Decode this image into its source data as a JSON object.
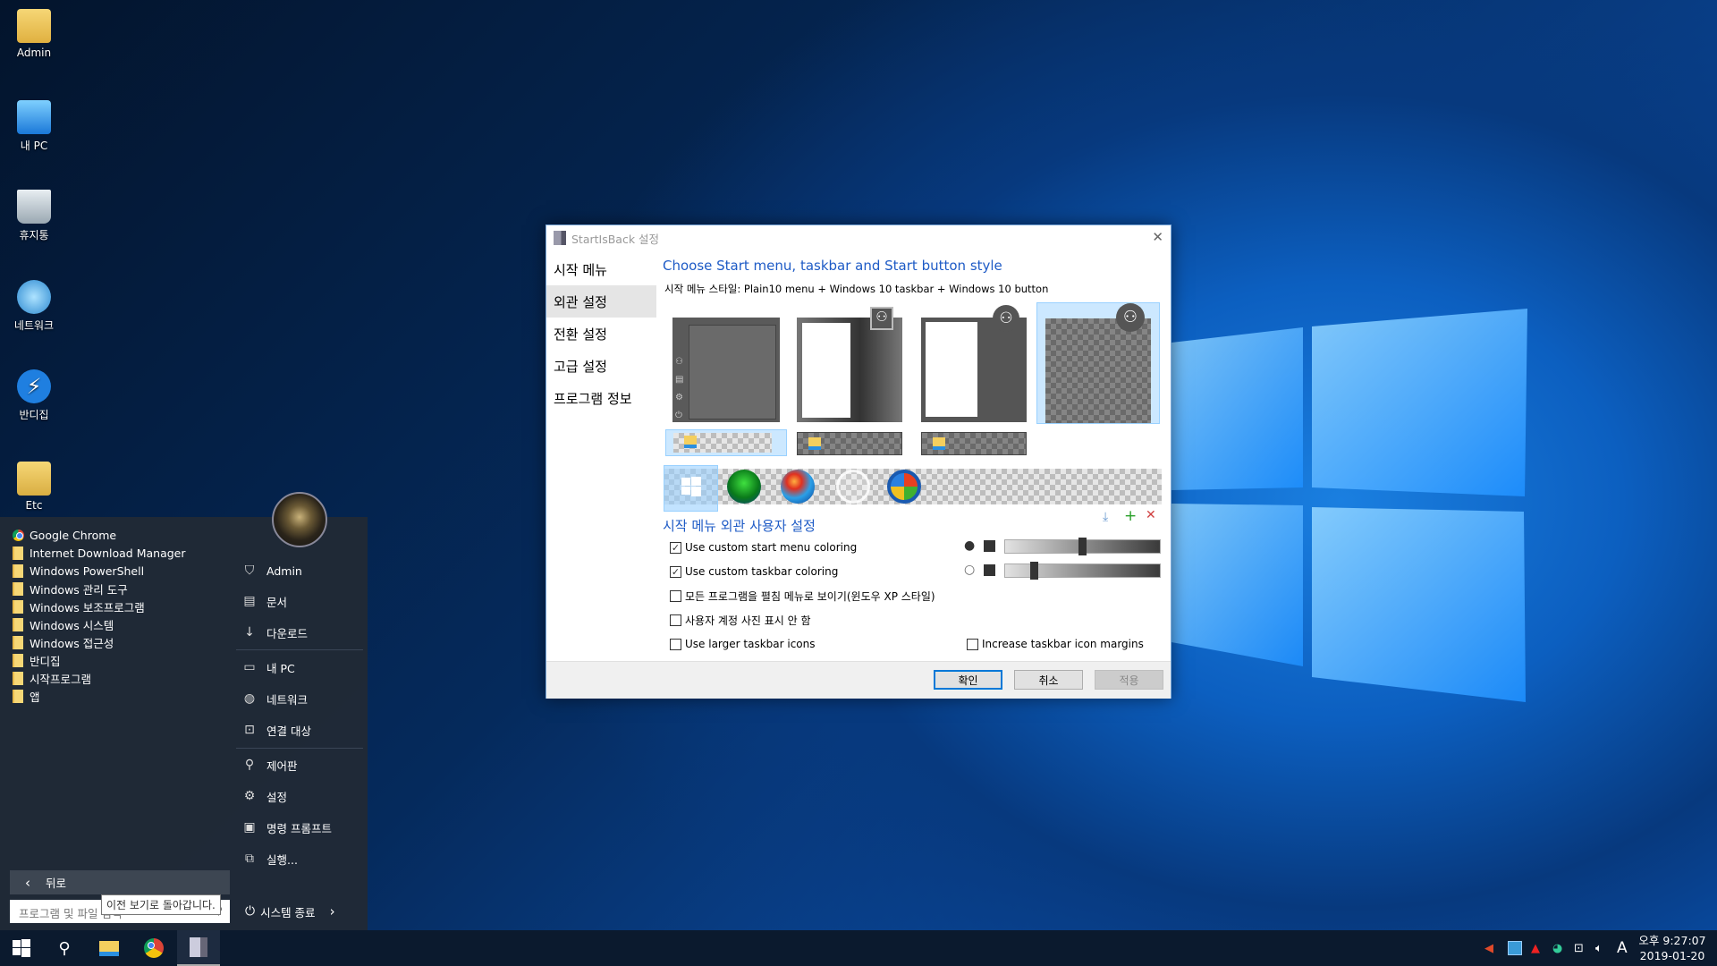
{
  "desktop": {
    "icons": [
      {
        "label": "Admin",
        "icon": "user-folder-icon"
      },
      {
        "label": "내 PC",
        "icon": "computer-icon"
      },
      {
        "label": "휴지통",
        "icon": "recycle-bin-icon"
      },
      {
        "label": "네트워크",
        "icon": "network-icon"
      },
      {
        "label": "반디집",
        "icon": "bandizip-icon"
      },
      {
        "label": "Etc",
        "icon": "folder-icon"
      }
    ]
  },
  "start_menu": {
    "programs": [
      {
        "label": "Google Chrome",
        "icon": "chrome-icon"
      },
      {
        "label": "Internet Download Manager",
        "icon": "folder-icon"
      },
      {
        "label": "Windows PowerShell",
        "icon": "folder-icon"
      },
      {
        "label": "Windows 관리 도구",
        "icon": "folder-icon"
      },
      {
        "label": "Windows 보조프로그램",
        "icon": "folder-icon"
      },
      {
        "label": "Windows 시스템",
        "icon": "folder-icon"
      },
      {
        "label": "Windows 접근성",
        "icon": "folder-icon"
      },
      {
        "label": "반디집",
        "icon": "folder-icon"
      },
      {
        "label": "시작프로그램",
        "icon": "folder-icon"
      },
      {
        "label": "앱",
        "icon": "folder-icon"
      }
    ],
    "places": [
      {
        "label": "Admin",
        "icon": "user-icon",
        "glyph": "⛉"
      },
      {
        "label": "문서",
        "icon": "document-icon",
        "glyph": "▤"
      },
      {
        "label": "다운로드",
        "icon": "download-icon",
        "glyph": "↓"
      },
      {
        "label": "내 PC",
        "icon": "computer-icon",
        "glyph": "▭"
      },
      {
        "label": "네트워크",
        "icon": "network-icon",
        "glyph": "◍"
      },
      {
        "label": "연결 대상",
        "icon": "connect-icon",
        "glyph": "⊡"
      },
      {
        "label": "제어판",
        "icon": "wrench-icon",
        "glyph": "⚲"
      },
      {
        "label": "설정",
        "icon": "gear-icon",
        "glyph": "⚙"
      },
      {
        "label": "명령 프롬프트",
        "icon": "cmd-icon",
        "glyph": "▣"
      },
      {
        "label": "실행...",
        "icon": "run-icon",
        "glyph": "⧉"
      }
    ],
    "back_label": "뒤로",
    "search_placeholder": "프로그램 및 파일 검색",
    "tooltip": "이전 보기로 돌아갑니다.",
    "shutdown_label": "시스템 종료"
  },
  "taskbar": {
    "items": [
      "start-button",
      "search-button",
      "file-explorer",
      "chrome",
      "startisback-settings"
    ],
    "active": "startisback-settings"
  },
  "tray": {
    "input_indicator": "A",
    "time": "오후 9:27:07",
    "date": "2019-01-20"
  },
  "dialog": {
    "title": "StartIsBack 설정",
    "nav": [
      {
        "label": "시작 메뉴"
      },
      {
        "label": "외관 설정",
        "selected": true
      },
      {
        "label": "전환 설정"
      },
      {
        "label": "고급 설정"
      },
      {
        "label": "프로그램 정보"
      }
    ],
    "heading": "Choose Start menu, taskbar and Start button style",
    "style_label": "시작 메뉴 스타일:",
    "style_value": "Plain10 menu + Windows 10 taskbar + Windows 10 button",
    "menu_styles_selected": 4,
    "taskbar_styles_selected": 1,
    "button_styles_selected": 1,
    "custom_heading": "시작 메뉴 외관 사용자 설정",
    "options": [
      {
        "label": "Use custom start menu coloring",
        "checked": true
      },
      {
        "label": "Use custom taskbar coloring",
        "checked": true
      },
      {
        "label": "모든 프로그램을 펼침 메뉴로 보이기(윈도우 XP 스타일)",
        "checked": false
      },
      {
        "label": "사용자 계정 사진 표시 안 함",
        "checked": false
      },
      {
        "label": "Use larger taskbar icons",
        "checked": false
      },
      {
        "label": "Increase taskbar icon margins",
        "checked": false
      }
    ],
    "start_menu_opacity_pct": 50,
    "taskbar_opacity_pct": 17,
    "color_swatch": "#333333",
    "accent": "#1e5bc6",
    "buttons": {
      "ok": "확인",
      "cancel": "취소",
      "apply": "적용"
    }
  }
}
